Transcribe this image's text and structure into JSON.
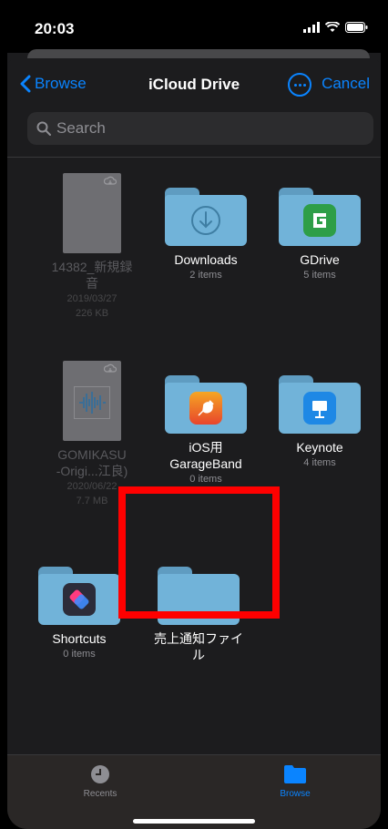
{
  "status": {
    "time": "20:03"
  },
  "nav": {
    "back_label": "Browse",
    "title": "iCloud Drive",
    "cancel_label": "Cancel"
  },
  "search": {
    "placeholder": "Search"
  },
  "items": [
    {
      "name": "14382_新規録",
      "name2": "音",
      "meta1": "2019/03/27",
      "meta2": "226 KB",
      "kind": "audio-file",
      "dimmed": true
    },
    {
      "name": "Downloads",
      "meta1": "2 items",
      "kind": "folder",
      "icon": "download-icon"
    },
    {
      "name": "GDrive",
      "meta1": "5 items",
      "kind": "folder",
      "icon": "gdrive-app-icon",
      "color": "#2e9e47"
    },
    {
      "name": "GOMIKASU",
      "name2": "-Origi...江良)",
      "meta1": "2020/06/22",
      "meta2": "7.7 MB",
      "kind": "audio-file",
      "dimmed": true
    },
    {
      "name": "iOS用",
      "name2": "GarageBand",
      "meta1": "0 items",
      "kind": "folder",
      "icon": "garageband-app-icon",
      "color": "#f05a28"
    },
    {
      "name": "Keynote",
      "meta1": "4 items",
      "kind": "folder",
      "icon": "keynote-app-icon",
      "color": "#1e88e5"
    },
    {
      "name": "Shortcuts",
      "meta1": "0 items",
      "kind": "folder",
      "icon": "shortcuts-app-icon",
      "color": "#3a3aa8"
    },
    {
      "name": "売上通知ファイ",
      "name2": "ル",
      "kind": "folder"
    }
  ],
  "tabbar": {
    "recents_label": "Recents",
    "browse_label": "Browse",
    "active_color": "#0a84ff"
  }
}
